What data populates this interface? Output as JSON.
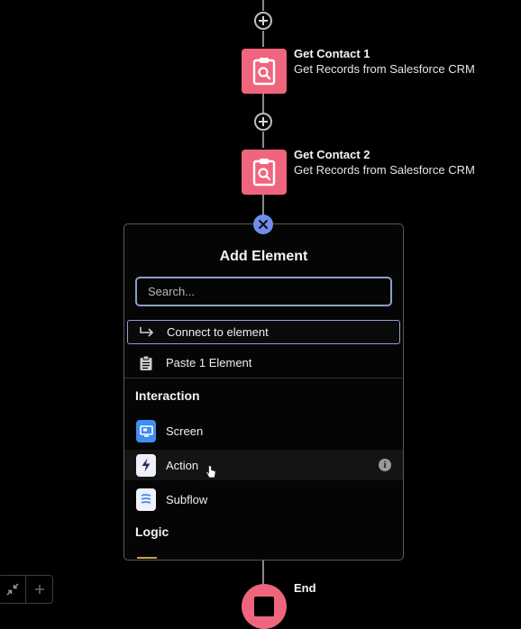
{
  "flow": {
    "nodes": [
      {
        "title": "Get Contact 1",
        "subtitle": "Get Records from Salesforce CRM"
      },
      {
        "title": "Get Contact 2",
        "subtitle": "Get Records from Salesforce CRM"
      }
    ],
    "end_label": "End"
  },
  "add_element_panel": {
    "title": "Add Element",
    "search_placeholder": "Search...",
    "connect_label": "Connect to element",
    "paste_label": "Paste 1 Element",
    "sections": [
      {
        "heading": "Interaction",
        "items": [
          {
            "label": "Screen",
            "icon": "screen-icon"
          },
          {
            "label": "Action",
            "icon": "lightning-icon"
          },
          {
            "label": "Subflow",
            "icon": "subflow-icon"
          }
        ]
      },
      {
        "heading": "Logic",
        "items": []
      }
    ]
  },
  "colors": {
    "node_pink": "#f0657e",
    "close_blue": "#6f8dec",
    "screen_tile": "#3f8ef0",
    "action_tile": "#eef0fb",
    "focus_border": "#8f9ec5"
  }
}
